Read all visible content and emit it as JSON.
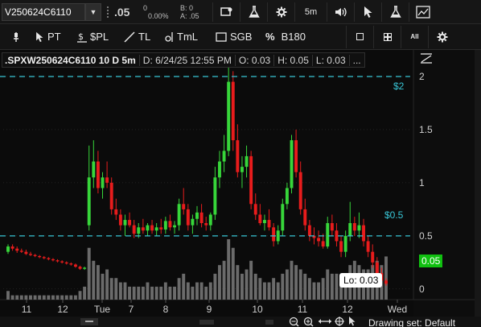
{
  "toolbar": {
    "symbol_value": "V250624C6110",
    "last_price": ".05",
    "change": "0",
    "change_pct": "0.00%",
    "bid": "B: 0",
    "ask": "A: .05",
    "timeframe_button": "5m"
  },
  "drawing_tools": {
    "pointer": "PT",
    "price_level": "$PL",
    "trendline": "TL",
    "timeline": "TmL",
    "sgb": "SGB",
    "percent": "B180",
    "all_label": "All"
  },
  "chart_header": {
    "symbol": ".SPXW250624C6110 10 D 5m",
    "date": "D: 6/24/25 12:55 PM",
    "open": "O: 0.03",
    "high": "H: 0.05",
    "low": "L: 0.03",
    "more": "..."
  },
  "price_labels": {
    "level_2": "$2",
    "level_05": "$0.5",
    "current": "0.05",
    "lo_label": "Lo: 0.03"
  },
  "status": {
    "drawing_set": "Drawing set: Default"
  },
  "chart_data": {
    "type": "candlestick",
    "y_axis_ticks": [
      "2",
      "1.5",
      "1",
      "0.5",
      "0"
    ],
    "ylim": [
      -0.1,
      2.25
    ],
    "x_axis_ticks": [
      "11",
      "12",
      "Tue",
      "7",
      "8",
      "9",
      "10",
      "11",
      "12",
      "Wed"
    ],
    "price_lines": [
      {
        "label": "$2",
        "value": 2.0,
        "color": "#38c6d6"
      },
      {
        "label": "$0.5",
        "value": 0.5,
        "color": "#38c6d6"
      }
    ],
    "last_value": 0.05,
    "low_annotation": 0.03,
    "colors": {
      "up": "#37d63a",
      "down": "#e81c1c",
      "volume": "#6b6b6b",
      "grid": "#3a3a3a",
      "current_price_bg": "#10c010"
    },
    "candles": [
      [
        0.35,
        0.42,
        0.33,
        0.4
      ],
      [
        0.4,
        0.42,
        0.36,
        0.38
      ],
      [
        0.38,
        0.4,
        0.34,
        0.36
      ],
      [
        0.36,
        0.38,
        0.34,
        0.35
      ],
      [
        0.35,
        0.37,
        0.32,
        0.33
      ],
      [
        0.33,
        0.35,
        0.31,
        0.32
      ],
      [
        0.32,
        0.33,
        0.3,
        0.31
      ],
      [
        0.31,
        0.32,
        0.29,
        0.3
      ],
      [
        0.3,
        0.31,
        0.28,
        0.29
      ],
      [
        0.29,
        0.3,
        0.27,
        0.28
      ],
      [
        0.28,
        0.29,
        0.26,
        0.27
      ],
      [
        0.27,
        0.28,
        0.25,
        0.26
      ],
      [
        0.26,
        0.27,
        0.24,
        0.25
      ],
      [
        0.25,
        0.26,
        0.23,
        0.24
      ],
      [
        0.24,
        0.25,
        0.22,
        0.23
      ],
      [
        0.23,
        0.24,
        0.2,
        0.21
      ],
      [
        0.21,
        0.22,
        0.18,
        0.19
      ],
      [
        0.19,
        0.21,
        0.18,
        0.2
      ],
      [
        0.6,
        1.35,
        0.55,
        1.05
      ],
      [
        1.05,
        1.4,
        0.95,
        1.2
      ],
      [
        1.2,
        1.3,
        0.9,
        0.95
      ],
      [
        0.95,
        1.1,
        0.85,
        1.05
      ],
      [
        1.05,
        1.2,
        0.95,
        1.0
      ],
      [
        1.0,
        1.05,
        0.7,
        0.75
      ],
      [
        0.75,
        0.85,
        0.65,
        0.7
      ],
      [
        0.7,
        0.75,
        0.55,
        0.6
      ],
      [
        0.6,
        0.7,
        0.5,
        0.65
      ],
      [
        0.65,
        0.72,
        0.58,
        0.6
      ],
      [
        0.6,
        0.65,
        0.48,
        0.52
      ],
      [
        0.52,
        0.62,
        0.48,
        0.58
      ],
      [
        0.58,
        0.66,
        0.52,
        0.55
      ],
      [
        0.55,
        0.62,
        0.5,
        0.6
      ],
      [
        0.6,
        0.65,
        0.52,
        0.55
      ],
      [
        0.55,
        0.62,
        0.5,
        0.58
      ],
      [
        0.58,
        0.66,
        0.52,
        0.56
      ],
      [
        0.56,
        0.68,
        0.52,
        0.64
      ],
      [
        0.64,
        0.7,
        0.55,
        0.58
      ],
      [
        0.58,
        0.64,
        0.52,
        0.6
      ],
      [
        0.6,
        0.85,
        0.55,
        0.8
      ],
      [
        0.8,
        0.95,
        0.7,
        0.75
      ],
      [
        0.75,
        0.8,
        0.55,
        0.6
      ],
      [
        0.6,
        0.7,
        0.52,
        0.66
      ],
      [
        0.66,
        0.78,
        0.6,
        0.72
      ],
      [
        0.72,
        0.8,
        0.58,
        0.62
      ],
      [
        0.62,
        0.68,
        0.55,
        0.6
      ],
      [
        0.6,
        0.72,
        0.55,
        0.7
      ],
      [
        0.7,
        1.15,
        0.65,
        1.05
      ],
      [
        1.05,
        1.3,
        0.95,
        1.2
      ],
      [
        1.2,
        1.45,
        1.1,
        1.3
      ],
      [
        1.3,
        2.18,
        1.25,
        1.95
      ],
      [
        1.95,
        2.05,
        1.3,
        1.4
      ],
      [
        1.4,
        1.55,
        1.05,
        1.1
      ],
      [
        1.1,
        1.25,
        0.95,
        1.15
      ],
      [
        1.15,
        1.35,
        1.05,
        1.25
      ],
      [
        1.25,
        1.3,
        0.75,
        0.8
      ],
      [
        0.8,
        0.9,
        0.65,
        0.7
      ],
      [
        0.7,
        0.8,
        0.6,
        0.62
      ],
      [
        0.62,
        0.7,
        0.55,
        0.65
      ],
      [
        0.65,
        0.75,
        0.55,
        0.58
      ],
      [
        0.58,
        0.62,
        0.4,
        0.45
      ],
      [
        0.45,
        0.6,
        0.42,
        0.55
      ],
      [
        0.55,
        0.85,
        0.5,
        0.8
      ],
      [
        0.8,
        1.0,
        0.75,
        0.95
      ],
      [
        0.95,
        1.45,
        0.9,
        1.4
      ],
      [
        1.4,
        1.5,
        1.05,
        1.1
      ],
      [
        1.1,
        1.2,
        0.7,
        0.75
      ],
      [
        0.75,
        0.85,
        0.55,
        0.6
      ],
      [
        0.6,
        0.65,
        0.45,
        0.5
      ],
      [
        0.5,
        0.58,
        0.42,
        0.48
      ],
      [
        0.48,
        0.55,
        0.4,
        0.45
      ],
      [
        0.45,
        0.52,
        0.38,
        0.4
      ],
      [
        0.4,
        0.68,
        0.38,
        0.62
      ],
      [
        0.62,
        0.7,
        0.5,
        0.55
      ],
      [
        0.55,
        0.62,
        0.4,
        0.45
      ],
      [
        0.45,
        0.5,
        0.3,
        0.35
      ],
      [
        0.35,
        0.55,
        0.3,
        0.5
      ],
      [
        0.5,
        0.82,
        0.45,
        0.62
      ],
      [
        0.62,
        0.68,
        0.5,
        0.55
      ],
      [
        0.55,
        0.72,
        0.48,
        0.6
      ],
      [
        0.6,
        0.66,
        0.4,
        0.45
      ],
      [
        0.45,
        0.5,
        0.3,
        0.35
      ],
      [
        0.35,
        0.42,
        0.2,
        0.25
      ],
      [
        0.25,
        0.3,
        0.1,
        0.15
      ],
      [
        0.15,
        0.2,
        0.05,
        0.08
      ],
      [
        0.08,
        0.1,
        0.03,
        0.05
      ]
    ],
    "volume": [
      2,
      1,
      1,
      1,
      1,
      1,
      1,
      1,
      1,
      1,
      1,
      1,
      1,
      1,
      1,
      1,
      2,
      3,
      12,
      9,
      8,
      6,
      7,
      5,
      5,
      4,
      4,
      3,
      3,
      3,
      3,
      4,
      3,
      3,
      3,
      4,
      3,
      3,
      5,
      6,
      4,
      3,
      4,
      4,
      3,
      4,
      6,
      8,
      9,
      14,
      12,
      8,
      6,
      7,
      9,
      6,
      5,
      4,
      4,
      5,
      4,
      6,
      7,
      9,
      8,
      7,
      6,
      5,
      4,
      4,
      5,
      7,
      6,
      6,
      5,
      6,
      8,
      9,
      8,
      7,
      7,
      8,
      9,
      8,
      10
    ]
  }
}
